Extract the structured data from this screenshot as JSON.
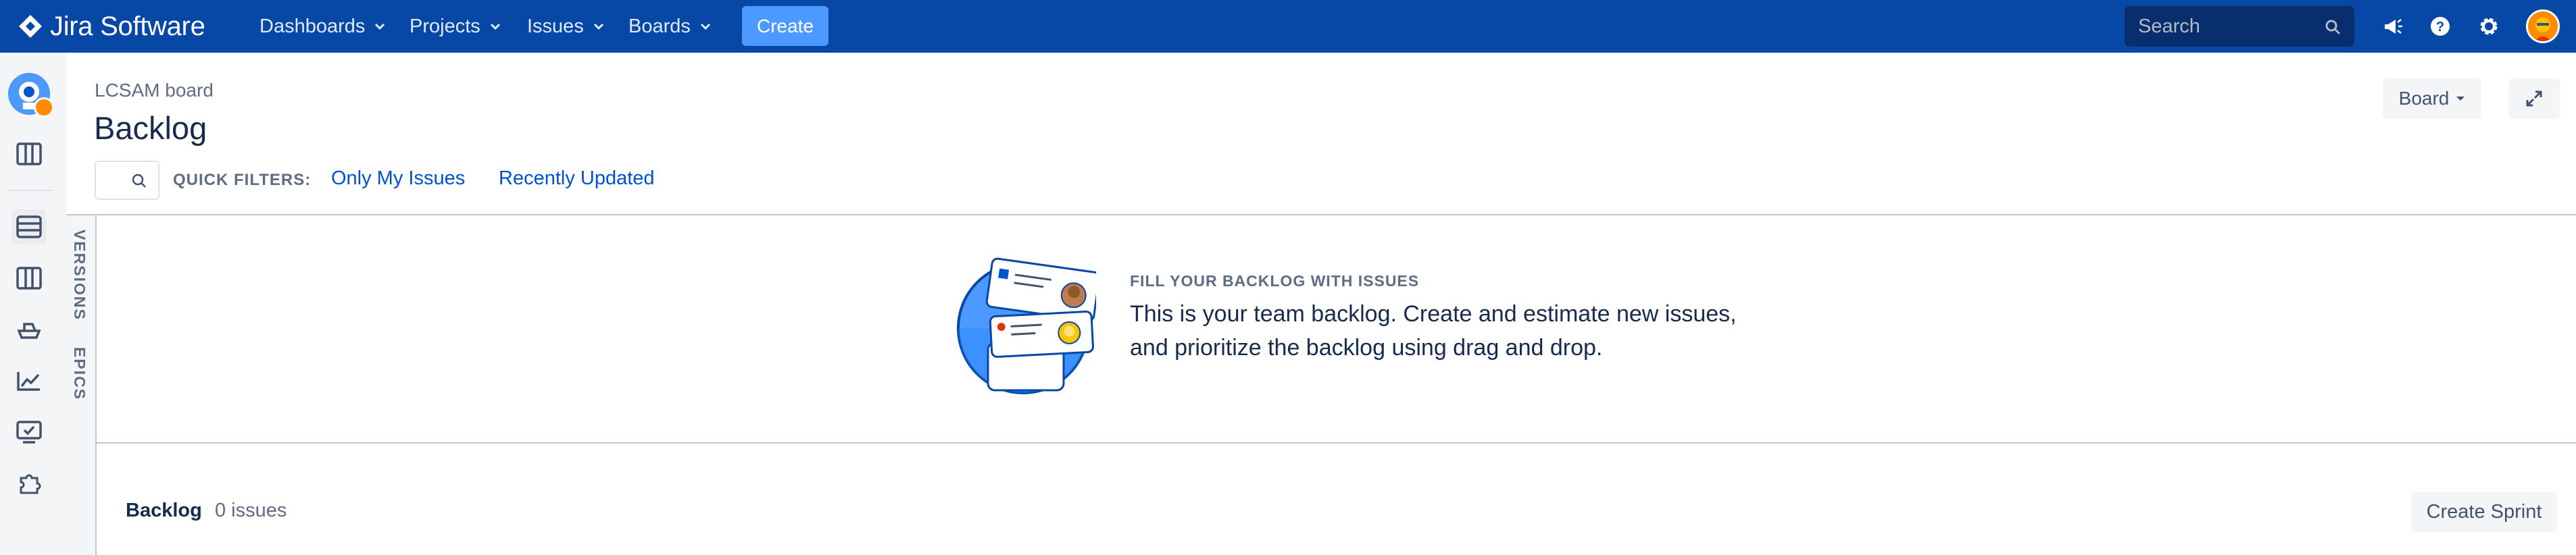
{
  "topnav": {
    "brand": "Jira Software",
    "menus": [
      {
        "label": "Dashboards"
      },
      {
        "label": "Projects"
      },
      {
        "label": "Issues"
      },
      {
        "label": "Boards"
      }
    ],
    "create_label": "Create",
    "search_placeholder": "Search",
    "icons": [
      "megaphone-icon",
      "help-icon",
      "settings-icon",
      "user-avatar"
    ]
  },
  "sidebar": {
    "items": [
      "project-avatar",
      "board-icon",
      "backlog-icon",
      "active-sprints-icon",
      "releases-icon",
      "reports-icon",
      "issues-icon",
      "add-ons-icon"
    ]
  },
  "header": {
    "breadcrumb": "LCSAM board",
    "title": "Backlog",
    "board_button": "Board"
  },
  "quick_filters": {
    "label": "QUICK FILTERS:",
    "filters": [
      "Only My Issues",
      "Recently Updated"
    ]
  },
  "side_tabs": {
    "versions": "VERSIONS",
    "epics": "EPICS"
  },
  "empty_state": {
    "heading": "FILL YOUR BACKLOG WITH ISSUES",
    "line1": "This is your team backlog. Create and estimate new issues,",
    "line2": "and prioritize the backlog using drag and drop."
  },
  "backlog": {
    "label": "Backlog",
    "count": "0 issues",
    "create_sprint": "Create Sprint"
  },
  "colors": {
    "nav_bg": "#0747A6",
    "create_btn": "#4C9AFF",
    "link": "#0052CC",
    "text": "#172B4D",
    "subtle_text": "#5E6C84"
  }
}
